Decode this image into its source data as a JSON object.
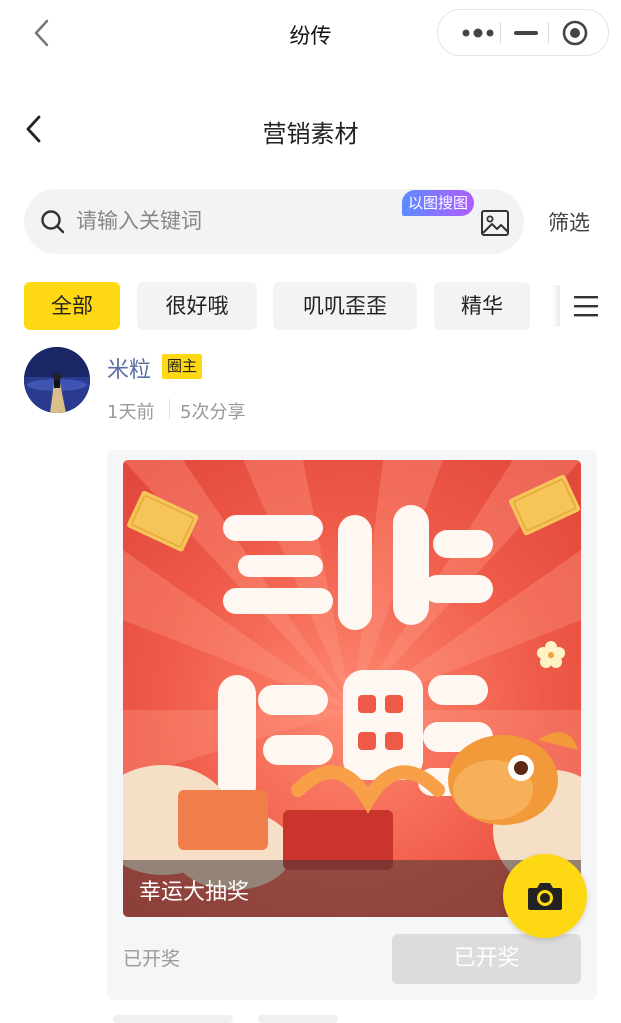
{
  "window": {
    "title": "纷传"
  },
  "page": {
    "title": "营销素材"
  },
  "search": {
    "placeholder": "请输入关键词",
    "image_search_badge": "以图搜图",
    "filter_label": "筛选"
  },
  "tabs": [
    {
      "label": "全部",
      "active": true
    },
    {
      "label": "很好哦",
      "active": false
    },
    {
      "label": "叽叽歪歪",
      "active": false
    },
    {
      "label": "精华",
      "active": false
    }
  ],
  "post": {
    "author": "米粒",
    "badge": "圈主",
    "time": "1天前",
    "shares": "5次分享",
    "caption": "幸运大抽奖",
    "status": "已开奖",
    "button_label": "已开奖"
  },
  "colors": {
    "accent": "#ffd814",
    "poster_red": "#ee5a4a"
  },
  "icons": [
    "back-icon",
    "more-dots-icon",
    "minimize-icon",
    "close-target-icon",
    "search-icon",
    "image-icon",
    "menu-icon",
    "camera-icon"
  ]
}
